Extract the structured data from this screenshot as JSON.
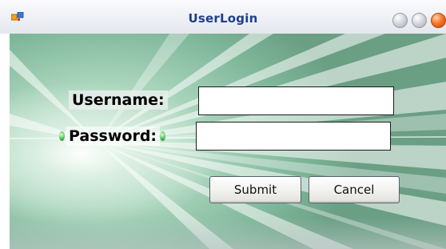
{
  "window": {
    "title": "UserLogin",
    "accent_title_color": "#203f8a",
    "close_color": "#f7772a"
  },
  "form": {
    "username_label": "Username:",
    "username_value": "",
    "username_placeholder": "",
    "password_label": "Password:",
    "password_value": "",
    "password_placeholder": ""
  },
  "buttons": {
    "submit_label": "Submit",
    "cancel_label": "Cancel"
  },
  "icons": {
    "app": "app-icon",
    "minimize": "minimize-icon",
    "maximize": "maximize-icon",
    "close": "close-icon"
  }
}
